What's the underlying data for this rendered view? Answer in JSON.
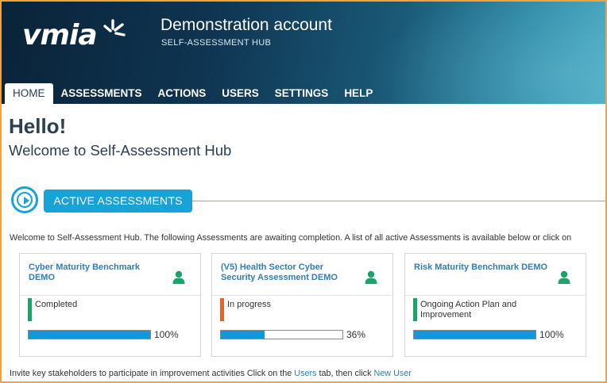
{
  "header": {
    "logo_text": "vmia",
    "account_name": "Demonstration account",
    "subtitle": "SELF-ASSESSMENT HUB"
  },
  "nav": {
    "tabs": [
      {
        "label": "HOME",
        "active": true
      },
      {
        "label": "ASSESSMENTS",
        "active": false
      },
      {
        "label": "ACTIONS",
        "active": false
      },
      {
        "label": "USERS",
        "active": false
      },
      {
        "label": "SETTINGS",
        "active": false
      },
      {
        "label": "HELP",
        "active": false
      }
    ]
  },
  "main": {
    "greeting": "Hello!",
    "welcome": "Welcome to Self-Assessment Hub",
    "section_title": "ACTIVE ASSESSMENTS",
    "intro": "Welcome to Self-Assessment Hub. The following Assessments are awaiting completion. A list of all active Assessments is available below or click on",
    "cards": [
      {
        "title": "Cyber Maturity Benchmark DEMO",
        "status": "Completed",
        "status_color": "#1aa36b",
        "progress": 100,
        "progress_label": "100%"
      },
      {
        "title": "(V5) Health Sector Cyber Security Assessment DEMO",
        "status": "In progress",
        "status_color": "#e8622a",
        "progress": 36,
        "progress_label": "36%"
      },
      {
        "title": "Risk Maturity Benchmark DEMO",
        "status": "Ongoing Action Plan and Improvement",
        "status_color": "#1aa36b",
        "progress": 100,
        "progress_label": "100%"
      }
    ],
    "footer": {
      "prefix": "Invite key stakeholders to participate in improvement activities Click on the ",
      "users_link": "Users",
      "middle": " tab, then click ",
      "new_user_link": "New User"
    }
  },
  "colors": {
    "accent": "#17a2d8",
    "heading": "#2b3f52",
    "link": "#2f7fb5",
    "progress": "#1596d6",
    "user_icon": "#1aa36b"
  }
}
